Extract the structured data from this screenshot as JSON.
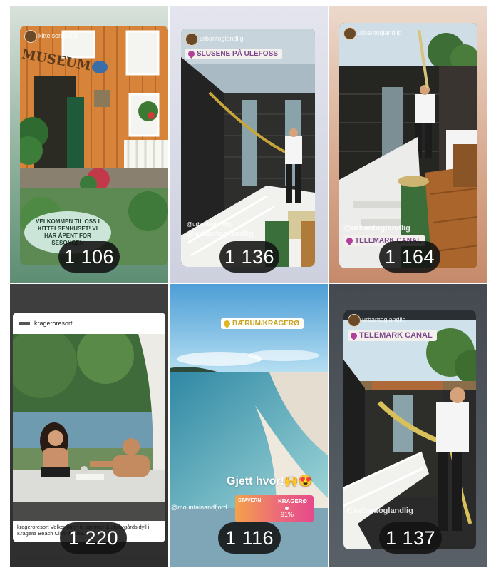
{
  "stories": [
    {
      "account": "kittelsenhuset",
      "sign": "MUSEUM",
      "speech": "VELKOMMEN TIL OSS I KITTELSENHUSET! VI HAR ÅPENT FOR SESONGEN",
      "count": "1 106"
    },
    {
      "account": "urbantoglandlig",
      "location": "SLUSENE PÅ ULEFOSS",
      "mention_small": "@urbantoglandlig",
      "mention": "@urbantoglandlig",
      "count": "1 136"
    },
    {
      "account": "urbantoglandlig",
      "mention": "@urbantoglandlig",
      "location": "TELEMARK CANAL",
      "count": "1 164"
    },
    {
      "account": "krageroresort",
      "caption": "krageroresort Velkommen til sommer & skjærgårdsidyll i Kragerø Beach Club ☀ Bea...",
      "count": "1 220"
    },
    {
      "location": "BÆRUM/KRAGERØ",
      "caption": "Gjett hvor!🙌😍",
      "mention": "@mountainandfjord",
      "slider_left": "STAVERN",
      "slider_right": "KRAGERØ",
      "slider_value": "91%",
      "count": "1 116"
    },
    {
      "account": "urbantoglandlig",
      "location": "TELEMARK CANAL",
      "mention": "@urbantoglandlig",
      "count": "1 137"
    }
  ],
  "colors": {
    "count_pill": "#121212",
    "location_text": "#7a4a8a"
  }
}
